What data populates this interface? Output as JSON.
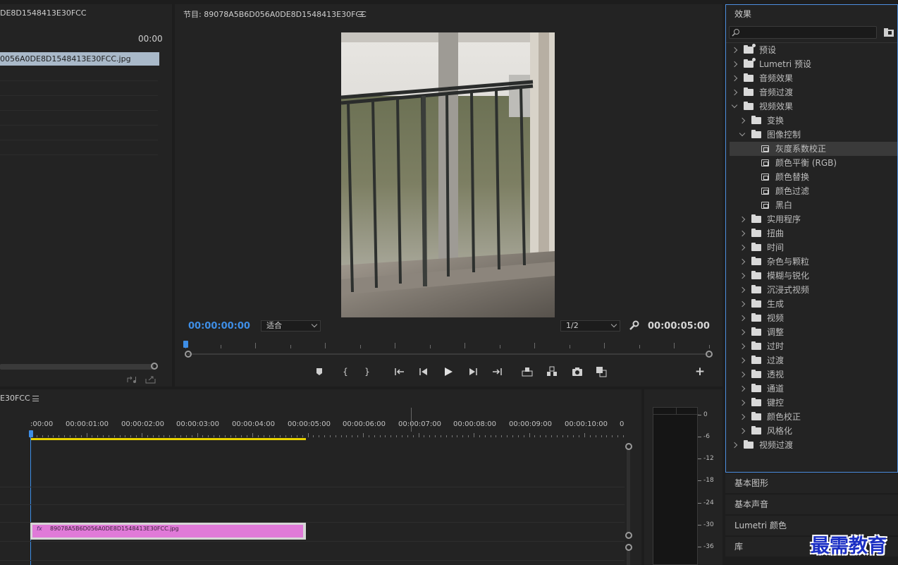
{
  "project_panel": {
    "title": "DE8D1548413E30FCC",
    "timecode": "00:00",
    "selected_item": "0056A0DE8D1548413E30FCC.jpg"
  },
  "program_monitor": {
    "title": "节目: 89078A5B6D056A0DE8D1548413E30FCC",
    "current_timecode": "00:00:00:00",
    "fit_select": "适合",
    "resolution_select": "1/2",
    "duration_timecode": "00:00:05:00",
    "controls": [
      "marker-icon",
      "mark-in-icon",
      "mark-out-icon",
      "go-to-in-icon",
      "step-back-icon",
      "play-icon",
      "step-forward-icon",
      "go-to-out-icon",
      "lift-icon",
      "extract-icon",
      "export-frame-icon",
      "comparison-view-icon",
      "add-button-icon"
    ]
  },
  "effects_panel": {
    "title": "效果",
    "search_placeholder": "",
    "tree": [
      {
        "label": "预设",
        "level": 0,
        "kind": "preset-folder",
        "expanded": false
      },
      {
        "label": "Lumetri 预设",
        "level": 0,
        "kind": "preset-folder",
        "expanded": false
      },
      {
        "label": "音频效果",
        "level": 0,
        "kind": "folder",
        "expanded": false
      },
      {
        "label": "音频过渡",
        "level": 0,
        "kind": "folder",
        "expanded": false
      },
      {
        "label": "视频效果",
        "level": 0,
        "kind": "folder",
        "expanded": true
      },
      {
        "label": "变换",
        "level": 1,
        "kind": "folder",
        "expanded": false
      },
      {
        "label": "图像控制",
        "level": 1,
        "kind": "folder",
        "expanded": true
      },
      {
        "label": "灰度系数校正",
        "level": 2,
        "kind": "effect",
        "selected": true
      },
      {
        "label": "颜色平衡 (RGB)",
        "level": 2,
        "kind": "effect"
      },
      {
        "label": "颜色替换",
        "level": 2,
        "kind": "effect"
      },
      {
        "label": "颜色过滤",
        "level": 2,
        "kind": "effect"
      },
      {
        "label": "黑白",
        "level": 2,
        "kind": "effect"
      },
      {
        "label": "实用程序",
        "level": 1,
        "kind": "folder",
        "expanded": false
      },
      {
        "label": "扭曲",
        "level": 1,
        "kind": "folder",
        "expanded": false
      },
      {
        "label": "时间",
        "level": 1,
        "kind": "folder",
        "expanded": false
      },
      {
        "label": "杂色与颗粒",
        "level": 1,
        "kind": "folder",
        "expanded": false
      },
      {
        "label": "模糊与锐化",
        "level": 1,
        "kind": "folder",
        "expanded": false
      },
      {
        "label": "沉浸式视频",
        "level": 1,
        "kind": "folder",
        "expanded": false
      },
      {
        "label": "生成",
        "level": 1,
        "kind": "folder",
        "expanded": false
      },
      {
        "label": "视频",
        "level": 1,
        "kind": "folder",
        "expanded": false
      },
      {
        "label": "调整",
        "level": 1,
        "kind": "folder",
        "expanded": false
      },
      {
        "label": "过时",
        "level": 1,
        "kind": "folder",
        "expanded": false
      },
      {
        "label": "过渡",
        "level": 1,
        "kind": "folder",
        "expanded": false
      },
      {
        "label": "透视",
        "level": 1,
        "kind": "folder",
        "expanded": false
      },
      {
        "label": "通道",
        "level": 1,
        "kind": "folder",
        "expanded": false
      },
      {
        "label": "键控",
        "level": 1,
        "kind": "folder",
        "expanded": false
      },
      {
        "label": "颜色校正",
        "level": 1,
        "kind": "folder",
        "expanded": false
      },
      {
        "label": "风格化",
        "level": 1,
        "kind": "folder",
        "expanded": false
      },
      {
        "label": "视频过渡",
        "level": 0,
        "kind": "folder",
        "expanded": false
      }
    ]
  },
  "side_panels": [
    "基本图形",
    "基本声音",
    "Lumetri 颜色",
    "库"
  ],
  "timeline": {
    "title": "E30FCC",
    "ruler_labels": [
      ":00:00",
      "00:00:01:00",
      "00:00:02:00",
      "00:00:03:00",
      "00:00:04:00",
      "00:00:05:00",
      "00:00:06:00",
      "00:00:07:00",
      "00:00:08:00",
      "00:00:09:00",
      "00:00:10:00",
      "0"
    ],
    "clip_label": "89078A5B6D056A0DE8D1548413E30FCC.jpg",
    "clip_fx": "fx",
    "clip_color": "#e07ad8"
  },
  "audio_meter": {
    "labels": [
      "0",
      "-6",
      "-12",
      "-18",
      "-24",
      "-30",
      "-36"
    ]
  },
  "watermark": "最需教育",
  "colors": {
    "accent_blue": "#3e8ee6",
    "clip_pink": "#e07ad8",
    "work_area_yellow": "#e8d200",
    "selection_bg": "#a9b9c9"
  }
}
